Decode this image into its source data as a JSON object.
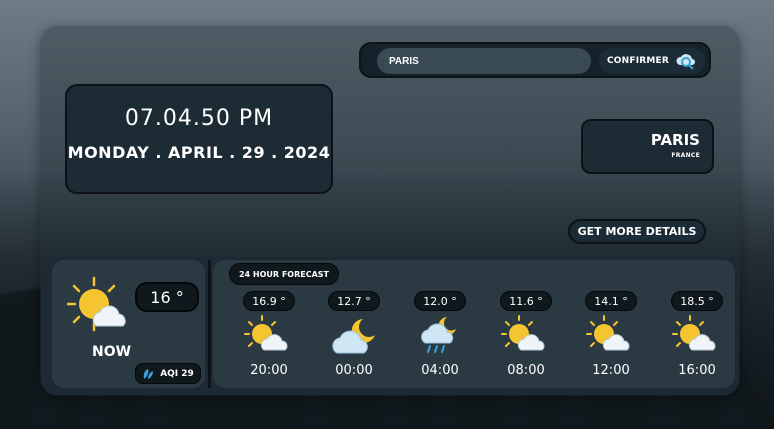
{
  "search": {
    "value": "PARIS",
    "confirm_label": "CONFIRMER"
  },
  "clock": {
    "time": "07.04.50 PM",
    "date": "MONDAY . APRIL . 29 . 2024"
  },
  "location": {
    "city": "PARIS",
    "country": "FRANCE"
  },
  "details_label": "GET MORE DETAILS",
  "now": {
    "temp": "16 °",
    "label": "NOW",
    "aqi": "AQI 29",
    "icon": "sun-behind-cloud-icon"
  },
  "forecast": {
    "title": "24 HOUR FORECAST",
    "slots": [
      {
        "temp": "16.9 °",
        "time": "20:00",
        "icon": "sun-behind-cloud-icon"
      },
      {
        "temp": "12.7 °",
        "time": "00:00",
        "icon": "moon-cloud-icon"
      },
      {
        "temp": "12.0 °",
        "time": "04:00",
        "icon": "moon-rain-cloud-icon"
      },
      {
        "temp": "11.6 °",
        "time": "08:00",
        "icon": "sun-behind-cloud-icon"
      },
      {
        "temp": "14.1 °",
        "time": "12:00",
        "icon": "sun-behind-cloud-icon"
      },
      {
        "temp": "18.5 °",
        "time": "16:00",
        "icon": "sun-behind-cloud-icon"
      }
    ]
  },
  "colors": {
    "panel": "#2b3943",
    "dark": "#0f181d",
    "accent": "#3aa0d8",
    "sun": "#f5c431"
  }
}
